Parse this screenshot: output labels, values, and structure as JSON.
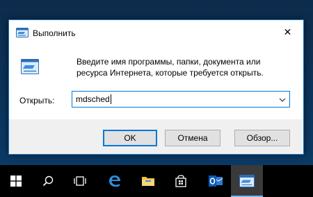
{
  "dialog": {
    "title": "Выполнить",
    "close_glyph": "✕",
    "description": "Введите имя программы, папки, документа или ресурса Интернета, которые требуется открыть.",
    "open_label": "Открыть:",
    "open_value": "mdsched",
    "buttons": {
      "ok": "OK",
      "cancel": "Отмена",
      "browse": "Обзор..."
    }
  },
  "taskbar": {
    "items": [
      "windows-start-icon",
      "search-icon",
      "task-view-icon",
      "edge-icon",
      "file-explorer-icon",
      "store-icon",
      "outlook-icon",
      "run-icon"
    ],
    "active": "run-icon"
  },
  "colors": {
    "accent": "#0078d7",
    "dialog_border": "#1979ca",
    "taskbar": "#000000",
    "footer": "#f0f0f0"
  }
}
